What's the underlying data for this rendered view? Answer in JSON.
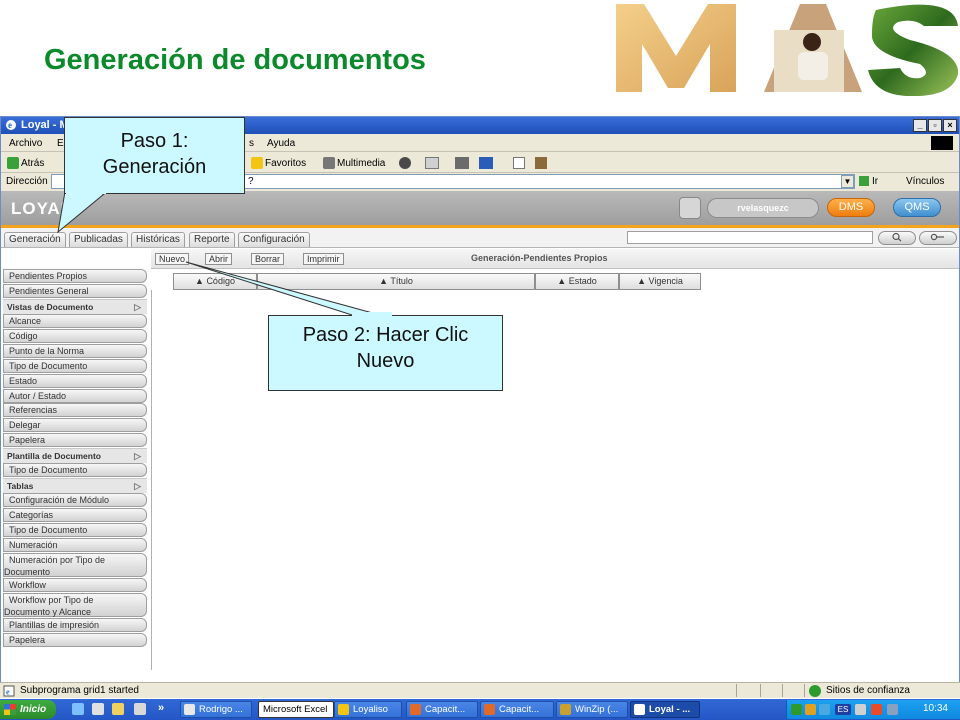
{
  "slide": {
    "title": "Generación de documentos"
  },
  "browser": {
    "title": "Loyal - M",
    "menu": [
      "Archivo",
      "E",
      "s",
      "Ayuda"
    ],
    "toolbar": {
      "back": "Atrás",
      "favorites": "Favoritos",
      "media": "Multimedia"
    },
    "address_label": "Dirección",
    "address_value": "?",
    "go": "Ir",
    "links": "Vínculos"
  },
  "app": {
    "logo": "LOYAL",
    "user": "rvelasquezc",
    "dms": "DMS",
    "qms": "QMS",
    "tabs": [
      "Generación",
      "Publicadas",
      "Históricas",
      "Reporte",
      "Configuración"
    ],
    "commands": [
      "Nuevo",
      "Abrir",
      "Borrar",
      "Imprimir"
    ],
    "panel_title": "Generación-Pendientes Propios",
    "columns": [
      "Código",
      "Título",
      "Estado",
      "Vigencia"
    ],
    "sidebar": {
      "top": [
        "Pendientes Propios",
        "Pendientes General"
      ],
      "views_header": "Vistas de Documento",
      "views": [
        "Alcance",
        "Código",
        "Punto de la Norma",
        "Tipo de Documento",
        "Estado",
        "Autor / Estado",
        "Referencias",
        "Delegar",
        "Papelera"
      ],
      "template_header": "Plantilla de Documento",
      "template": [
        "Tipo de Documento"
      ],
      "tables_header": "Tablas",
      "tables_a": [
        "Configuración de Módulo",
        "Categorías",
        "Tipo de Documento",
        "Numeración"
      ],
      "tables_b1": "Numeración por Tipo de",
      "tables_b2": "Documento",
      "tables_c": "Workflow",
      "tables_d1": "Workflow por Tipo de",
      "tables_d2": "Documento y Alcance",
      "tables_e": [
        "Plantillas de impresión",
        "Papelera"
      ]
    }
  },
  "status": {
    "text": "Subprograma grid1 started",
    "zone": "Sitios de confianza"
  },
  "taskbar": {
    "start": "Inicio",
    "more": "»",
    "tasks": [
      "Rodrigo ...",
      "Microsoft Excel",
      "Loyaliso",
      "Capacit...",
      "Capacit...",
      "WinZip (...",
      "Loyal - ..."
    ],
    "lang": "ES",
    "clock": "10:34"
  },
  "callouts": {
    "step1_line1": "Paso 1:",
    "step1_line2": "Generación",
    "step2_line1": "Paso 2: Hacer Clic",
    "step2_line2": "Nuevo"
  },
  "colors": {
    "title_green": "#0a8a2a",
    "accent_orange": "#f4a41a",
    "callout_fill": "#ccf8ff"
  }
}
